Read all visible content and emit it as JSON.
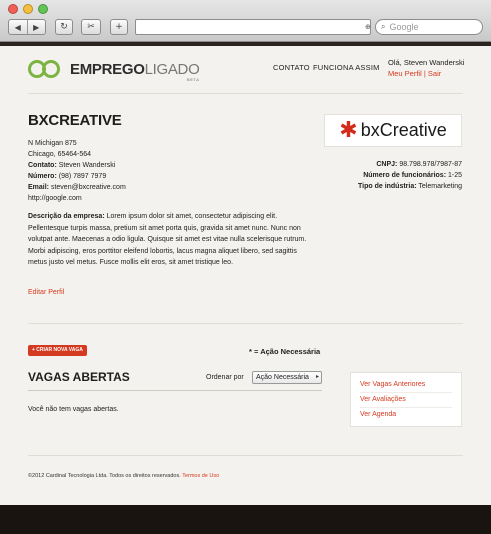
{
  "browser": {
    "nav_back": "◀",
    "nav_forward": "▶",
    "reload_icon": "↻",
    "clip_icon": "✂",
    "add_icon": "+",
    "rss_icon": "⊕",
    "search_icon": "⌕",
    "search_placeholder": "Google"
  },
  "header": {
    "logo_bold": "EMPREGO",
    "logo_light": "LIGADO",
    "logo_badge": "BETA",
    "nav": [
      "CONTATO",
      "FUNCIONA ASSIM"
    ],
    "greeting": "Olá, Steven Wanderski",
    "profile_link": "Meu Perfil",
    "separator": "|",
    "logout_link": "Sair"
  },
  "company": {
    "name": "BXCREATIVE",
    "street": "N Michigan 875",
    "city": "Chicago, 65464-564",
    "contact_label": "Contato:",
    "contact_value": "Steven Wanderski",
    "phone_label": "Número:",
    "phone_value": "(98) 7897 7979",
    "email_label": "Email:",
    "email_value": "steven@bxcreative.com",
    "website": "http://google.com",
    "description_label": "Descrição da empresa:",
    "description": "Lorem ipsum dolor sit amet, consectetur adipiscing elit. Pellentesque turpis massa, pretium sit amet porta quis, gravida sit amet nunc. Nunc non volutpat ante. Maecenas a odio ligula. Quisque sit amet est vitae nulla scelerisque rutrum. Morbi adipiscing, eros porttitor eleifend lobortis, lacus magna aliquet libero, sed sagittis metus justo vel metus. Fusce mollis elit eros, sit amet tristique leo.",
    "edit_link": "Editar Perfil",
    "logo_star": "✱",
    "logo_word": "bxCreative",
    "cnpj_label": "CNPJ:",
    "cnpj_value": "98.798.978/7987-87",
    "employees_label": "Número de funcionários:",
    "employees_value": "1-25",
    "industry_label": "Tipo de indústria:",
    "industry_value": "Telemarketing"
  },
  "jobs": {
    "create_button": "+ CRIAR NOVA VAGA",
    "legend": "* = Ação Necessária",
    "title": "VAGAS ABERTAS",
    "sort_label": "Ordenar por",
    "sort_value": "Ação Necessária",
    "sort_arrow": "▸",
    "empty_message": "Você não tem vagas abertas."
  },
  "sidebar": {
    "links": [
      "Ver Vagas Anteriores",
      "Ver Avaliações",
      "Ver Agenda"
    ]
  },
  "footer": {
    "copyright": "©2012 Cardinal Tecnologia Ltda. Todos os direitos reservados.",
    "terms_link": "Termos de Uso"
  },
  "colors": {
    "accent": "#d43a1f",
    "brand_green": "#7cb342",
    "page_background": "#f4f2ee",
    "dark_band": "#1a1411"
  }
}
